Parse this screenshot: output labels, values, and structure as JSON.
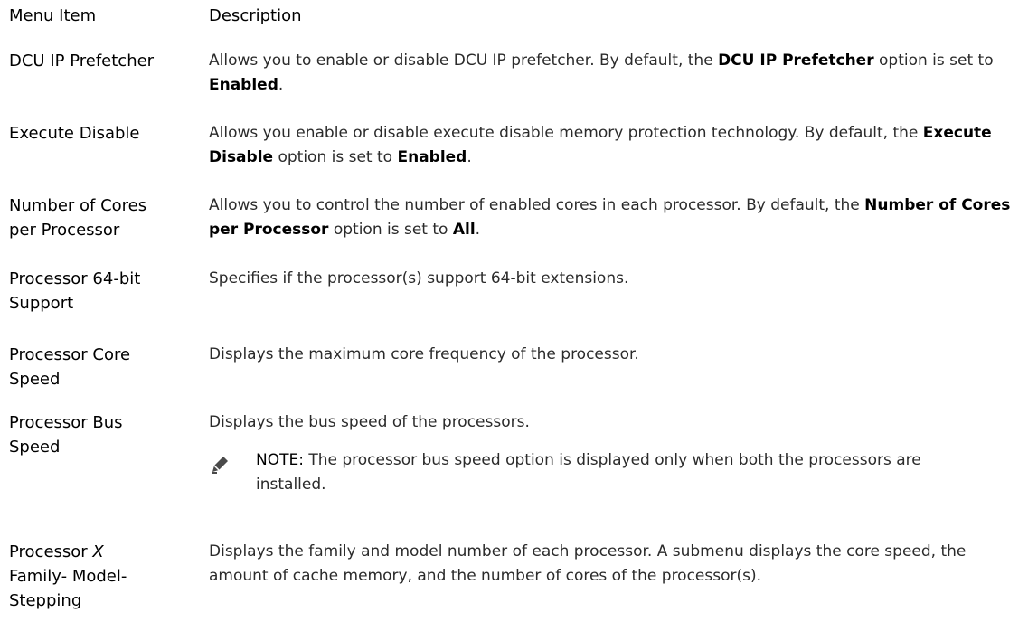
{
  "header": {
    "menu_item": "Menu Item",
    "description": "Description"
  },
  "rows": [
    {
      "item": "DCU IP Prefetcher",
      "desc_pre": "Allows you to enable or disable DCU IP prefetcher. By default, the ",
      "desc_bold1": "DCU IP Prefetcher",
      "desc_mid": " option is set to ",
      "desc_bold2": "Enabled",
      "desc_post": "."
    },
    {
      "item": "Execute Disable",
      "desc_pre": "Allows you enable or disable execute disable memory protection technology. By default, the ",
      "desc_bold1": "Execute Disable",
      "desc_mid": " option is set to ",
      "desc_bold2": "Enabled",
      "desc_post": "."
    },
    {
      "item_line1": "Number of Cores",
      "item_line2": "per Processor",
      "desc_pre": "Allows you to control the number of enabled cores in each processor. By default, the ",
      "desc_bold1": "Number of Cores per Processor",
      "desc_mid": " option is set to ",
      "desc_bold2": "All",
      "desc_post": "."
    },
    {
      "item_line1": "Processor 64-bit",
      "item_line2": "Support",
      "desc": "Specifies if the processor(s) support 64-bit extensions."
    },
    {
      "item_line1": "Processor Core",
      "item_line2": "Speed",
      "desc": "Displays the maximum core frequency of the processor."
    },
    {
      "item_line1": "Processor Bus",
      "item_line2": "Speed",
      "desc": "Displays the bus speed of the processors.",
      "note_label": "NOTE:",
      "note_text": " The processor bus speed option is displayed only when both the processors are installed.",
      "note_icon": "pencil-note-icon"
    },
    {
      "item_pre": "Processor ",
      "item_italic": "X",
      "item_line2": "Family- Model-",
      "item_line3": "Stepping",
      "desc": "Displays the family and model number of each processor. A submenu displays the core speed, the amount of cache memory, and the number of cores of the processor(s)."
    }
  ]
}
